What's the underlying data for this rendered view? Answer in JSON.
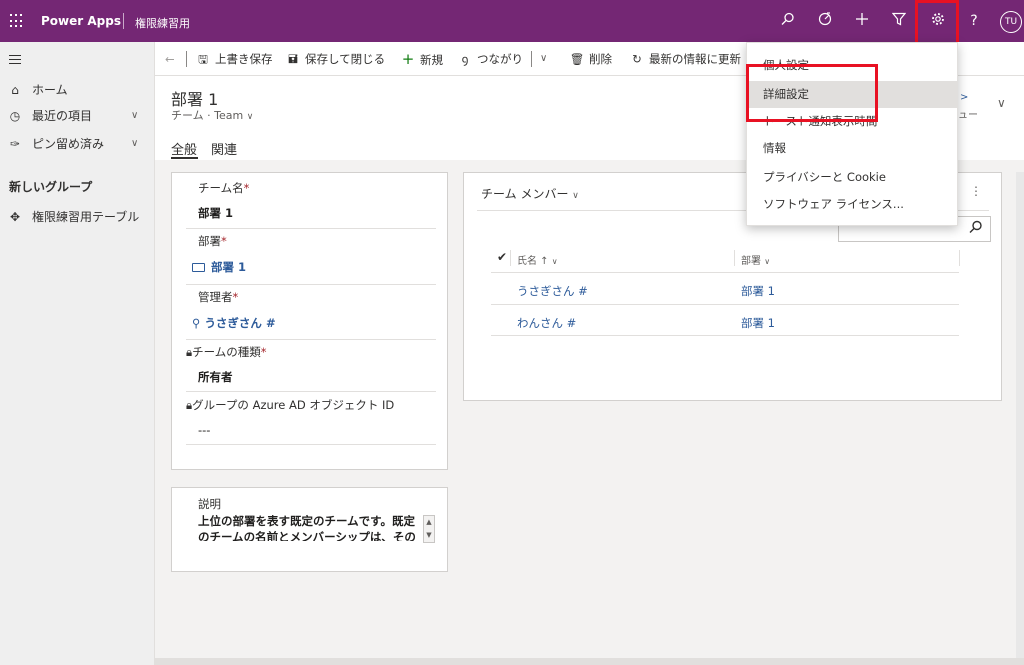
{
  "header": {
    "brand": "Power Apps",
    "app_name": "権限練習用",
    "avatar": "TU",
    "icons": [
      "search-icon",
      "target-icon",
      "plus-icon",
      "filter-icon",
      "gear-icon",
      "help-icon"
    ]
  },
  "leftnav": {
    "items": [
      {
        "label": "ホーム",
        "icon": "home-icon"
      },
      {
        "label": "最近の項目",
        "icon": "clock-icon"
      },
      {
        "label": "ピン留め済み",
        "icon": "pin-icon"
      }
    ],
    "group_title": "新しいグループ",
    "group_items": [
      {
        "label": "権限練習用テーブル",
        "icon": "puzzle-icon"
      }
    ]
  },
  "commands": {
    "save": "上書き保存",
    "save_close": "保存して閉じる",
    "new": "新規",
    "connect": "つながり",
    "delete": "削除",
    "refresh": "最新の情報に更新"
  },
  "record": {
    "title": "部署 1",
    "subtitle": "チーム · Team",
    "tabs": [
      "全般",
      "関連"
    ]
  },
  "form": {
    "team_name_label": "チーム名",
    "team_name_value": "部署 1",
    "dept_label": "部署",
    "dept_value": "部署 1",
    "manager_label": "管理者",
    "manager_value": "うさぎさん #",
    "team_type_label": "チームの種類",
    "team_type_value": "所有者",
    "azure_label": "グループの Azure AD オブジェクト ID",
    "azure_value": "---",
    "required_mark": "*",
    "desc_label": "説明",
    "desc_line1": "上位の部署を表す既定のチームです。既定",
    "desc_line2": "のチームの名前とメンバーシップは、その"
  },
  "members": {
    "title": "チーム メンバー",
    "col_name": "氏名 ↑",
    "col_dept": "部署",
    "rows": [
      {
        "name": "うさぎさん #",
        "dept": "部署 1"
      },
      {
        "name": "わんさん #",
        "dept": "部署 1"
      }
    ]
  },
  "settings_menu": {
    "items": [
      "個人設定",
      "詳細設定",
      "トースト通知表示時間",
      "情報",
      "プライバシーと Cookie",
      "ソフトウェア ライセンス..."
    ],
    "highlighted": "詳細設定"
  },
  "peek": {
    "chevron_text": ">",
    "partial_label": "ュー"
  },
  "colors": {
    "topbar": "#742774",
    "highlight_box": "#e81123",
    "link": "#2d5b9a"
  }
}
